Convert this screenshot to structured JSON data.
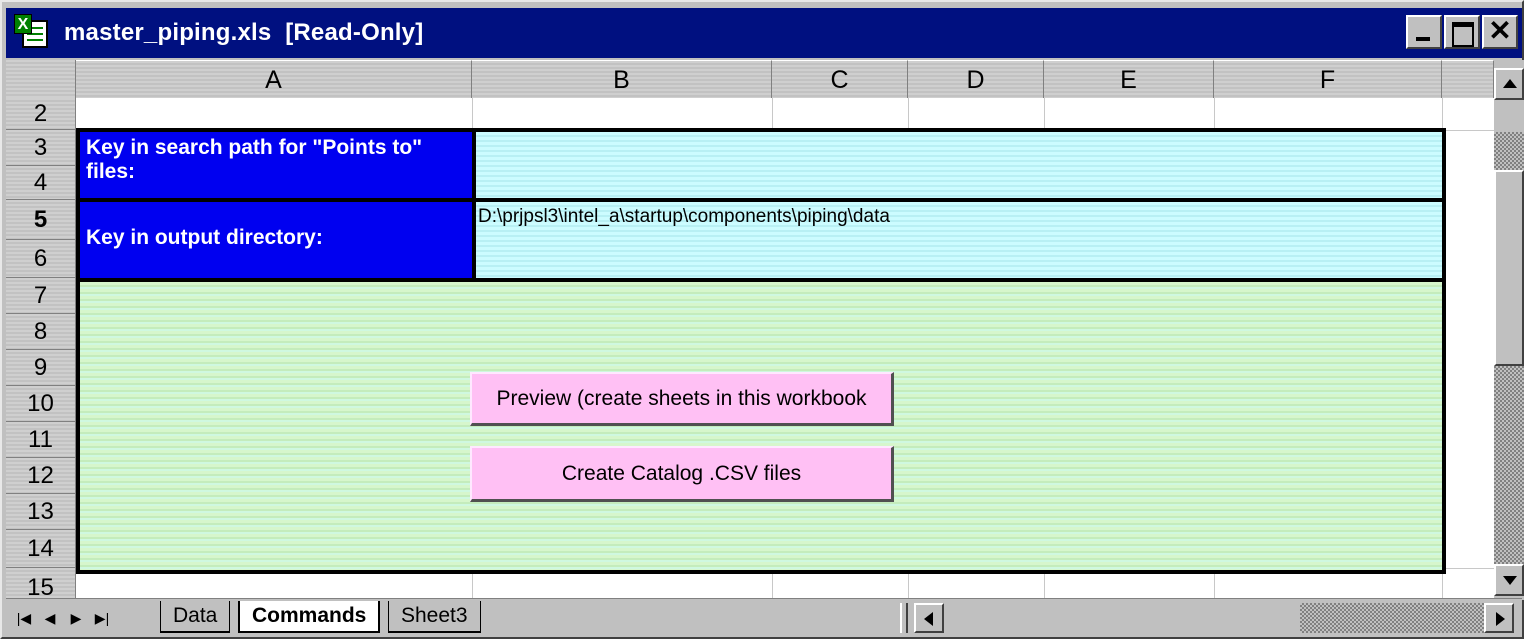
{
  "window": {
    "title": "master_piping.xls  [Read-Only]",
    "close_glyph": "✕"
  },
  "columns": [
    "A",
    "B",
    "C",
    "D",
    "E",
    "F"
  ],
  "rows": [
    "2",
    "3",
    "4",
    "5",
    "6",
    "7",
    "8",
    "9",
    "10",
    "11",
    "12",
    "13",
    "14",
    "15"
  ],
  "cells": {
    "search_path_label": "Key in search path for \"Points to\" files:",
    "search_path_value": "",
    "output_dir_label": "Key in output directory:",
    "output_dir_value": "D:\\prjpsl3\\intel_a\\startup\\components\\piping\\data"
  },
  "buttons": {
    "preview": "Preview (create sheets in this workbook",
    "create_csv": "Create Catalog .CSV files"
  },
  "tabs": {
    "items": [
      "Data",
      "Commands",
      "Sheet3"
    ],
    "active": "Commands"
  },
  "nav": {
    "first": "|◀",
    "prev": "◀",
    "next": "▶",
    "last": "▶|"
  },
  "colors": {
    "titlebar": "#001080",
    "label_bg": "#0000f0",
    "input_bg": "#ccfcff",
    "area_bg": "#d6f6cc",
    "button_bg": "#ffc0f4"
  }
}
